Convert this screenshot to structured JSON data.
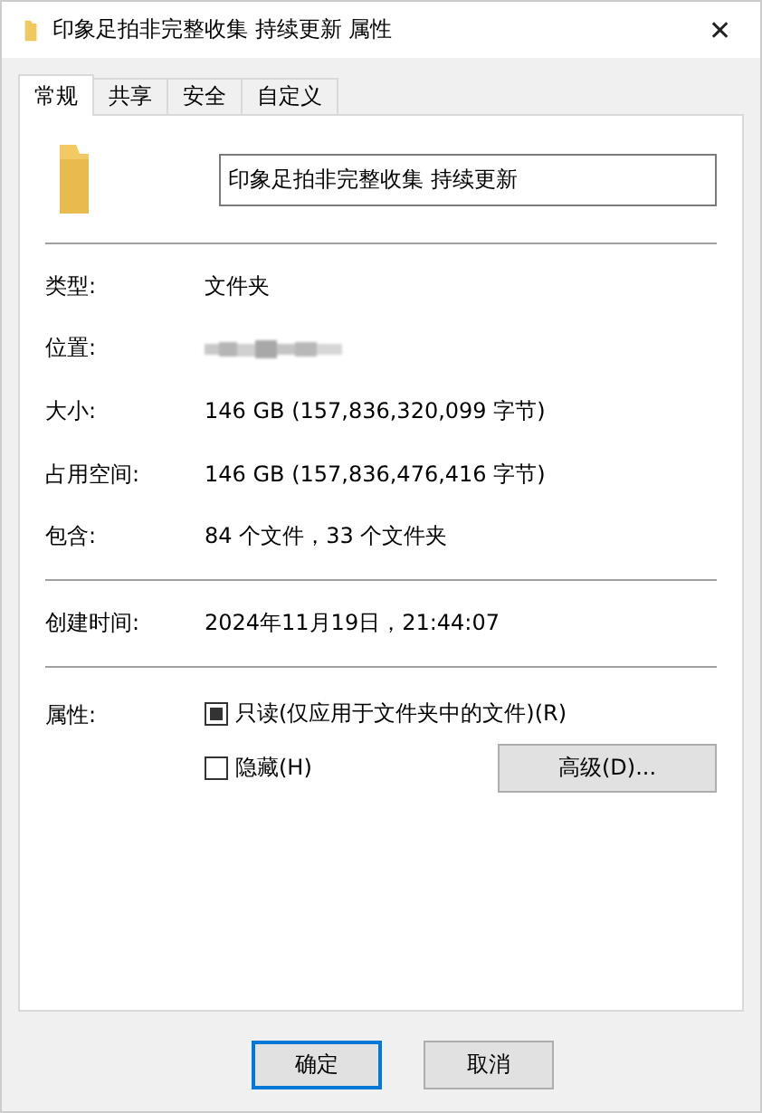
{
  "window": {
    "title": "印象足拍非完整收集 持续更新 属性",
    "close": "✕"
  },
  "tabs": [
    {
      "label": "常规",
      "selected": true
    },
    {
      "label": "共享",
      "selected": false
    },
    {
      "label": "安全",
      "selected": false
    },
    {
      "label": "自定义",
      "selected": false
    }
  ],
  "name_field": {
    "value": "印象足拍非完整收集 持续更新"
  },
  "groups": [
    [
      {
        "label": "类型:",
        "value": "文件夹"
      },
      {
        "label": "位置:",
        "kind": "redacted"
      },
      {
        "label": "大小:",
        "value": "146 GB (157,836,320,099 字节)"
      },
      {
        "label": "占用空间:",
        "value": "146 GB (157,836,476,416 字节)"
      },
      {
        "label": "包含:",
        "value": "84 个文件，33 个文件夹"
      }
    ],
    [
      {
        "label": "创建时间:",
        "value": "2024年11月19日，21:44:07"
      }
    ]
  ],
  "attributes": {
    "label": "属性:",
    "checkboxes": [
      {
        "label": "只读(仅应用于文件夹中的文件)(R)",
        "checked": false,
        "indeterminate": true
      },
      {
        "label": "隐藏(H)",
        "checked": false,
        "indeterminate": false
      }
    ],
    "advanced_button": "高级(D)..."
  },
  "buttons": [
    {
      "label": "确定",
      "default": true
    },
    {
      "label": "取消",
      "default": false
    }
  ]
}
